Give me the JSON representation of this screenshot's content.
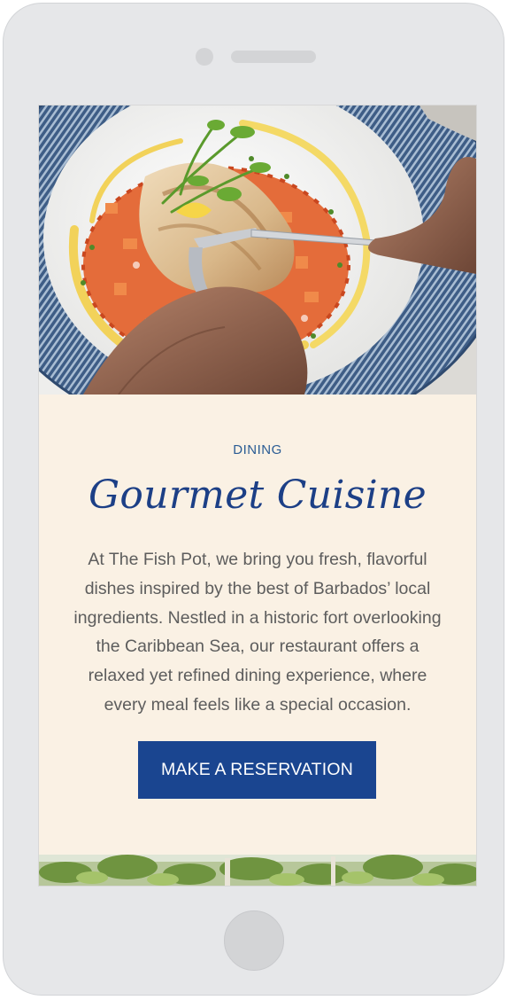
{
  "device": {
    "frame_color": "#e6e7e9",
    "icons": [
      "front-camera-icon",
      "speaker-grille-icon",
      "home-button-icon"
    ]
  },
  "hero": {
    "image": "plated-fish-dish-photo"
  },
  "section": {
    "eyebrow": "DINING",
    "title": "Gourmet Cuisine",
    "body": "At The Fish Pot, we bring you fresh, flavorful dishes inspired by the best of Barbados’ local ingredients. Nestled in a historic fort overlooking the Caribbean Sea, our restaurant offers a  relaxed yet refined dining experience, where every meal feels like a special occasion.",
    "cta_label": "MAKE A RESERVATION"
  },
  "colors": {
    "background": "#faf1e4",
    "accent": "#1a4590",
    "title": "#1c3f86",
    "eyebrow": "#2a5c94",
    "body_text": "#5d5d5d"
  },
  "next_section": {
    "image": "garden-foliage-photo"
  }
}
